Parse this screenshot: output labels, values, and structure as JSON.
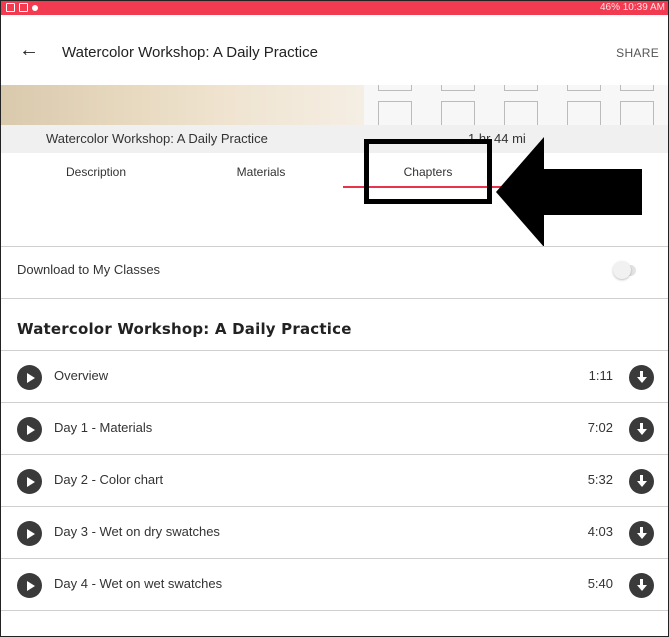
{
  "status_bar": {
    "right_text": "46% 10:39 AM"
  },
  "header": {
    "title": "Watercolor Workshop: A Daily Practice",
    "share_label": "SHARE"
  },
  "info": {
    "course_name": "Watercolor Workshop: A Daily Practice",
    "duration": "1 hr 44 mi"
  },
  "tabs": [
    {
      "label": "Description"
    },
    {
      "label": "Materials"
    },
    {
      "label": "Chapters"
    }
  ],
  "download": {
    "label": "Download to My Classes"
  },
  "section": {
    "title": "Watercolor Workshop: A Daily Practice"
  },
  "chapters": [
    {
      "title": "Overview",
      "duration": "1:11"
    },
    {
      "title": "Day 1 - Materials",
      "duration": "7:02"
    },
    {
      "title": "Day 2 - Color chart",
      "duration": "5:32"
    },
    {
      "title": "Day 3 - Wet on dry swatches",
      "duration": "4:03"
    },
    {
      "title": "Day 4 - Wet on wet swatches",
      "duration": "5:40"
    }
  ],
  "colors": {
    "accent": "#f23a50",
    "tab_indicator": "#e8334a"
  },
  "icons": {
    "back": "arrow-left-icon",
    "play": "play-circle-icon",
    "download": "download-circle-icon",
    "annotation": "arrow-left-pointer-icon"
  }
}
